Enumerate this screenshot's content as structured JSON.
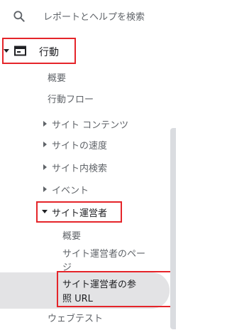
{
  "search": {
    "placeholder_text": "レポートとヘルプを検索"
  },
  "nav": {
    "behavior": {
      "label": "行動"
    },
    "overview": {
      "label": "概要"
    },
    "behavior_flow": {
      "label": "行動フロー"
    },
    "site_content": {
      "label": "サイト コンテンツ"
    },
    "site_speed": {
      "label": "サイトの速度"
    },
    "site_search": {
      "label": "サイト内検索"
    },
    "events": {
      "label": "イベント"
    },
    "publisher": {
      "label": "サイト運営者",
      "children": [
        {
          "label": "概要"
        },
        {
          "label_line1": "サイト運営者のペー",
          "label_line2": "ジ"
        },
        {
          "label_line1": "サイト運営者の参",
          "label_line2": "照 URL"
        }
      ]
    },
    "web_test": {
      "label": "ウェブテスト"
    }
  },
  "colors": {
    "highlight_box": "#e5252a",
    "selected_bg": "#e3e3e5",
    "text": "#202124",
    "secondary_text": "#5f6368"
  }
}
